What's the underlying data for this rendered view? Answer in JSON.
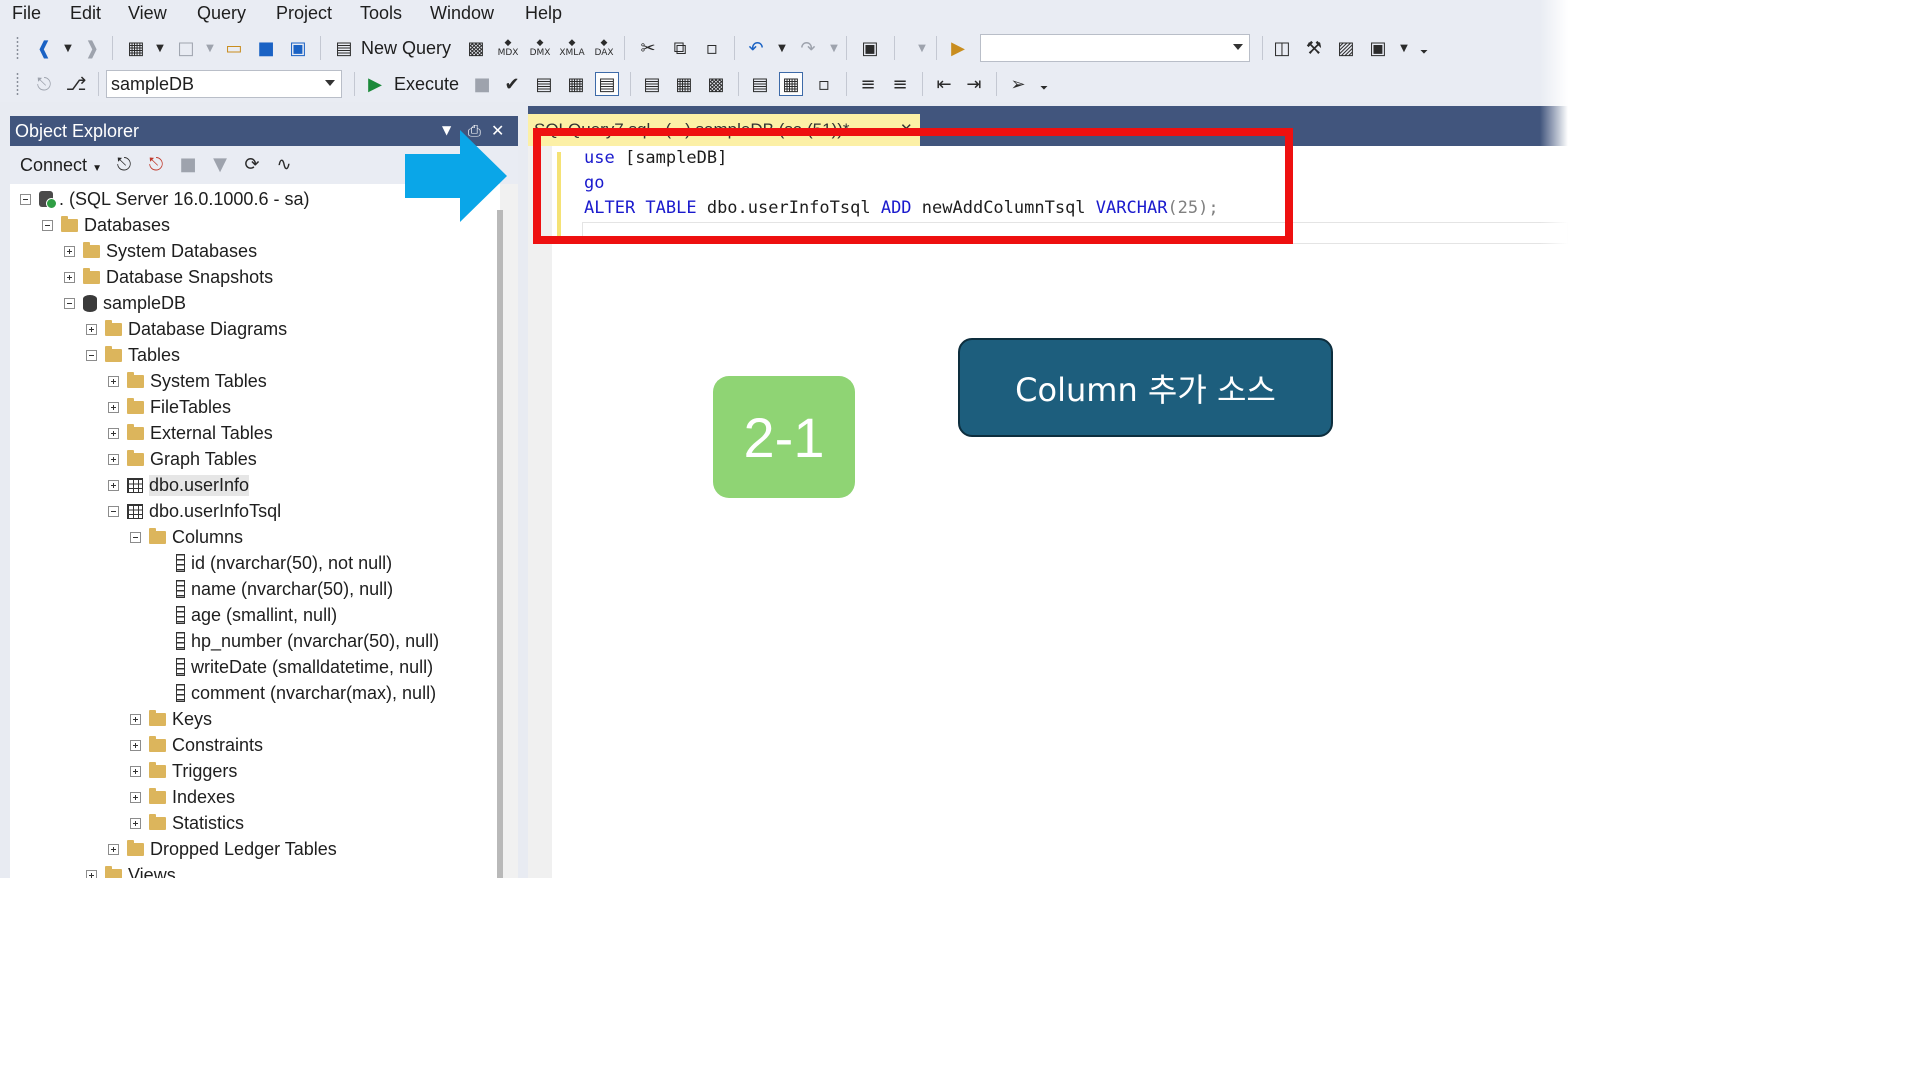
{
  "menu": [
    "File",
    "Edit",
    "View",
    "Query",
    "Project",
    "Tools",
    "Window",
    "Help"
  ],
  "toolbar1": {
    "new_query_label": "New Query",
    "icon_labels": [
      "MDX",
      "DMX",
      "XMLA",
      "DAX"
    ],
    "search_value": ""
  },
  "toolbar2": {
    "database": "sampleDB",
    "execute_label": "Execute"
  },
  "object_explorer": {
    "title": "Object Explorer",
    "connect_label": "Connect",
    "server": ". (SQL Server 16.0.1000.6 - sa)",
    "nodes": [
      "Databases",
      "System Databases",
      "Database Snapshots",
      "sampleDB",
      "Database Diagrams",
      "Tables",
      "System Tables",
      "FileTables",
      "External Tables",
      "Graph Tables",
      "dbo.userInfo",
      "dbo.userInfoTsql",
      "Columns",
      "id (nvarchar(50), not null)",
      "name (nvarchar(50), null)",
      "age (smallint, null)",
      "hp_number (nvarchar(50), null)",
      "writeDate (smalldatetime, null)",
      "comment (nvarchar(max), null)",
      "Keys",
      "Constraints",
      "Triggers",
      "Indexes",
      "Statistics",
      "Dropped Ledger Tables",
      "Views"
    ]
  },
  "editor": {
    "tab_title": "SQLQuery7.sql - (...).sampleDB (sa (51))*",
    "line1": {
      "kw": "use",
      "rest": " [sampleDB]"
    },
    "line2": {
      "kw": "go"
    },
    "line3": {
      "kw1": "ALTER TABLE",
      "t1": " dbo.userInfoTsql ",
      "kw2": "ADD",
      "t2": " newAddColumnTsql ",
      "kw3": "VARCHAR",
      "t3": "(25);"
    }
  },
  "annotations": {
    "step_badge": "2-1",
    "note": "Column 추가 소스"
  },
  "colors": {
    "accent_header": "#41557d",
    "highlight_box": "#ee1010",
    "arrow": "#0aa6e8",
    "step_badge": "#8fd474",
    "note_badge": "#1d5e7d",
    "sql_keyword": "#1a1acd"
  }
}
